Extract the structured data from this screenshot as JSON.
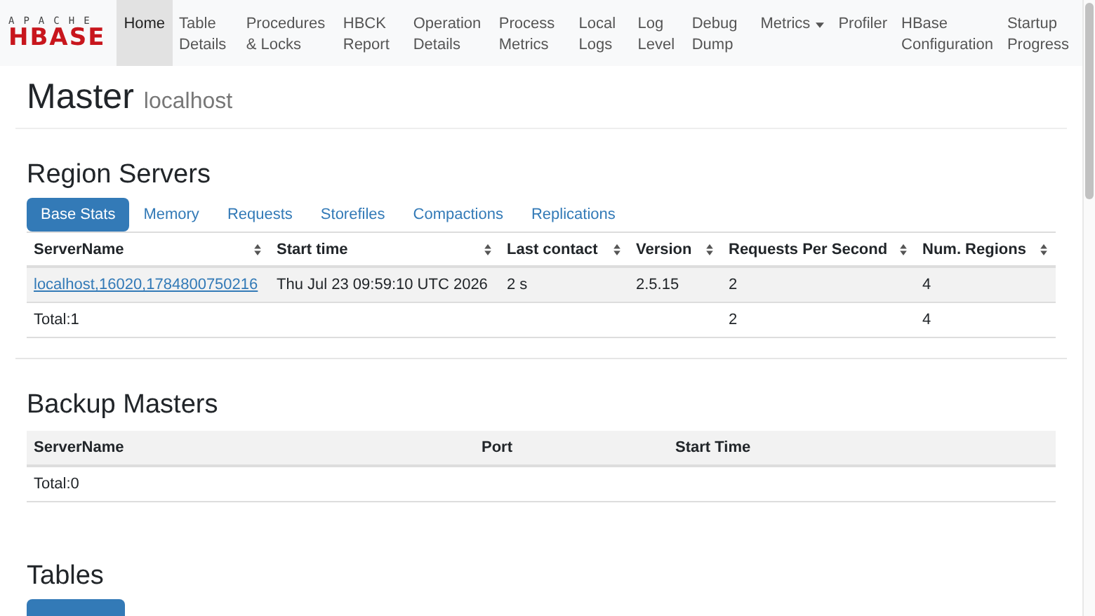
{
  "navbar": {
    "logo": {
      "top": "APACHE",
      "bottom": "HBASE"
    },
    "items": [
      {
        "label": "Home",
        "selected": true,
        "kind": "link"
      },
      {
        "label": "Table Details",
        "selected": false,
        "kind": "link"
      },
      {
        "label": "Procedures & Locks",
        "selected": false,
        "kind": "link"
      },
      {
        "label": "HBCK Report",
        "selected": false,
        "kind": "link"
      },
      {
        "label": "Operation Details",
        "selected": false,
        "kind": "link"
      },
      {
        "label": "Process Metrics",
        "selected": false,
        "kind": "link"
      },
      {
        "label": "Local Logs",
        "selected": false,
        "kind": "link"
      },
      {
        "label": "Log Level",
        "selected": false,
        "kind": "link"
      },
      {
        "label": "Debug Dump",
        "selected": false,
        "kind": "link"
      },
      {
        "label": "Metrics",
        "selected": false,
        "kind": "dropdown"
      },
      {
        "label": "Profiler",
        "selected": false,
        "kind": "link"
      },
      {
        "label": "HBase Configuration",
        "selected": false,
        "kind": "link"
      },
      {
        "label": "Startup Progress",
        "selected": false,
        "kind": "link"
      }
    ]
  },
  "page_header": {
    "title": "Master",
    "subtitle": "localhost"
  },
  "sections": [
    {
      "title": "Region Servers",
      "tabs": [
        {
          "label": "Base Stats",
          "selected": true
        },
        {
          "label": "Memory",
          "selected": false
        },
        {
          "label": "Requests",
          "selected": false
        },
        {
          "label": "Storefiles",
          "selected": false
        },
        {
          "label": "Compactions",
          "selected": false
        },
        {
          "label": "Replications",
          "selected": false
        }
      ],
      "table": {
        "sortable": true,
        "columns": [
          "ServerName",
          "Start time",
          "Last contact",
          "Version",
          "Requests Per Second",
          "Num. Regions"
        ],
        "rows": [
          {
            "cells": [
              "localhost,16020,1784800750216",
              "Thu Jul 23 09:59:10 UTC 2026",
              "2 s",
              "2.5.15",
              "2",
              "4"
            ],
            "link_first": true
          },
          {
            "cells": [
              "Total:1",
              "",
              "",
              "",
              "2",
              "4"
            ],
            "link_first": false
          }
        ]
      }
    },
    {
      "title": "Backup Masters",
      "table": {
        "sortable": false,
        "columns": [
          "ServerName",
          "Port",
          "Start Time"
        ],
        "rows": [
          {
            "cells": [
              "Total:0",
              "",
              ""
            ],
            "link_first": false
          }
        ]
      }
    },
    {
      "title": "Tables",
      "tabs": [
        {
          "selected": true
        }
      ]
    }
  ]
}
